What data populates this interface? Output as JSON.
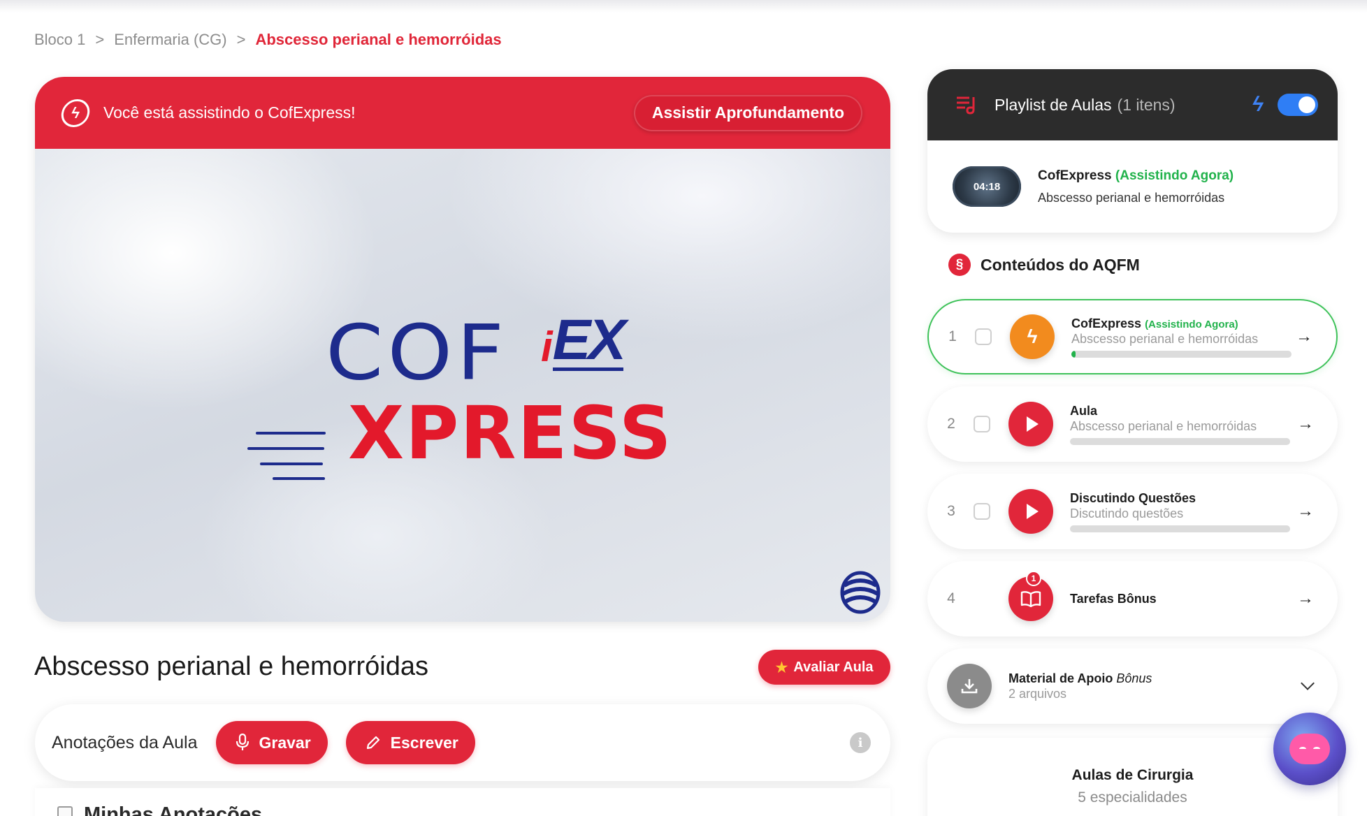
{
  "breadcrumb": {
    "items": [
      "Bloco 1",
      "Enfermaria (CG)"
    ],
    "current": "Abscesso perianal e hemorróidas",
    "separator": ">"
  },
  "player": {
    "banner_text": "Você está assistindo o CofExpress!",
    "deep_button": "Assistir Aprofundamento",
    "logo_top": "COF",
    "logo_ex_i": "i",
    "logo_ex": "EX",
    "logo_bottom": "XPRESS"
  },
  "lesson": {
    "title": "Abscesso perianal e hemorróidas",
    "rate_button": "Avaliar Aula"
  },
  "notes": {
    "label": "Anotações da Aula",
    "record_button": "Gravar",
    "write_button": "Escrever",
    "my_notes_title": "Minhas Anotações"
  },
  "playlist": {
    "title": "Playlist de Aulas",
    "count": "(1 itens)",
    "toggle_on": true,
    "now_playing": {
      "duration": "04:18",
      "name": "CofExpress",
      "status": "(Assistindo Agora)",
      "subtitle": "Abscesso perianal e hemorróidas"
    }
  },
  "contents": {
    "title": "Conteúdos do AQFM",
    "items": [
      {
        "num": "1",
        "title": "CofExpress",
        "status": "(Assistindo Agora)",
        "subtitle": "Abscesso perianal e hemorróidas",
        "progress": 0.02
      },
      {
        "num": "2",
        "title": "Aula",
        "status": "",
        "subtitle": "Abscesso perianal e hemorróidas",
        "progress": 0
      },
      {
        "num": "3",
        "title": "Discutindo Questões",
        "status": "",
        "subtitle": "Discutindo questões",
        "progress": 0
      },
      {
        "num": "4",
        "title": "Tarefas Bônus",
        "badge": "1"
      }
    ],
    "material": {
      "title": "Material de Apoio",
      "title_italic": "Bônus",
      "subtitle": "2 arquivos"
    }
  },
  "surgery": {
    "title": "Aulas de Cirurgia",
    "subtitle": "5 especialidades"
  },
  "colors": {
    "brand_red": "#e1263a",
    "active_green": "#21b24b",
    "toggle_blue": "#2f7ef5",
    "logo_navy": "#1d2b8c"
  },
  "icons": {
    "arrow": "→",
    "star": "★"
  }
}
